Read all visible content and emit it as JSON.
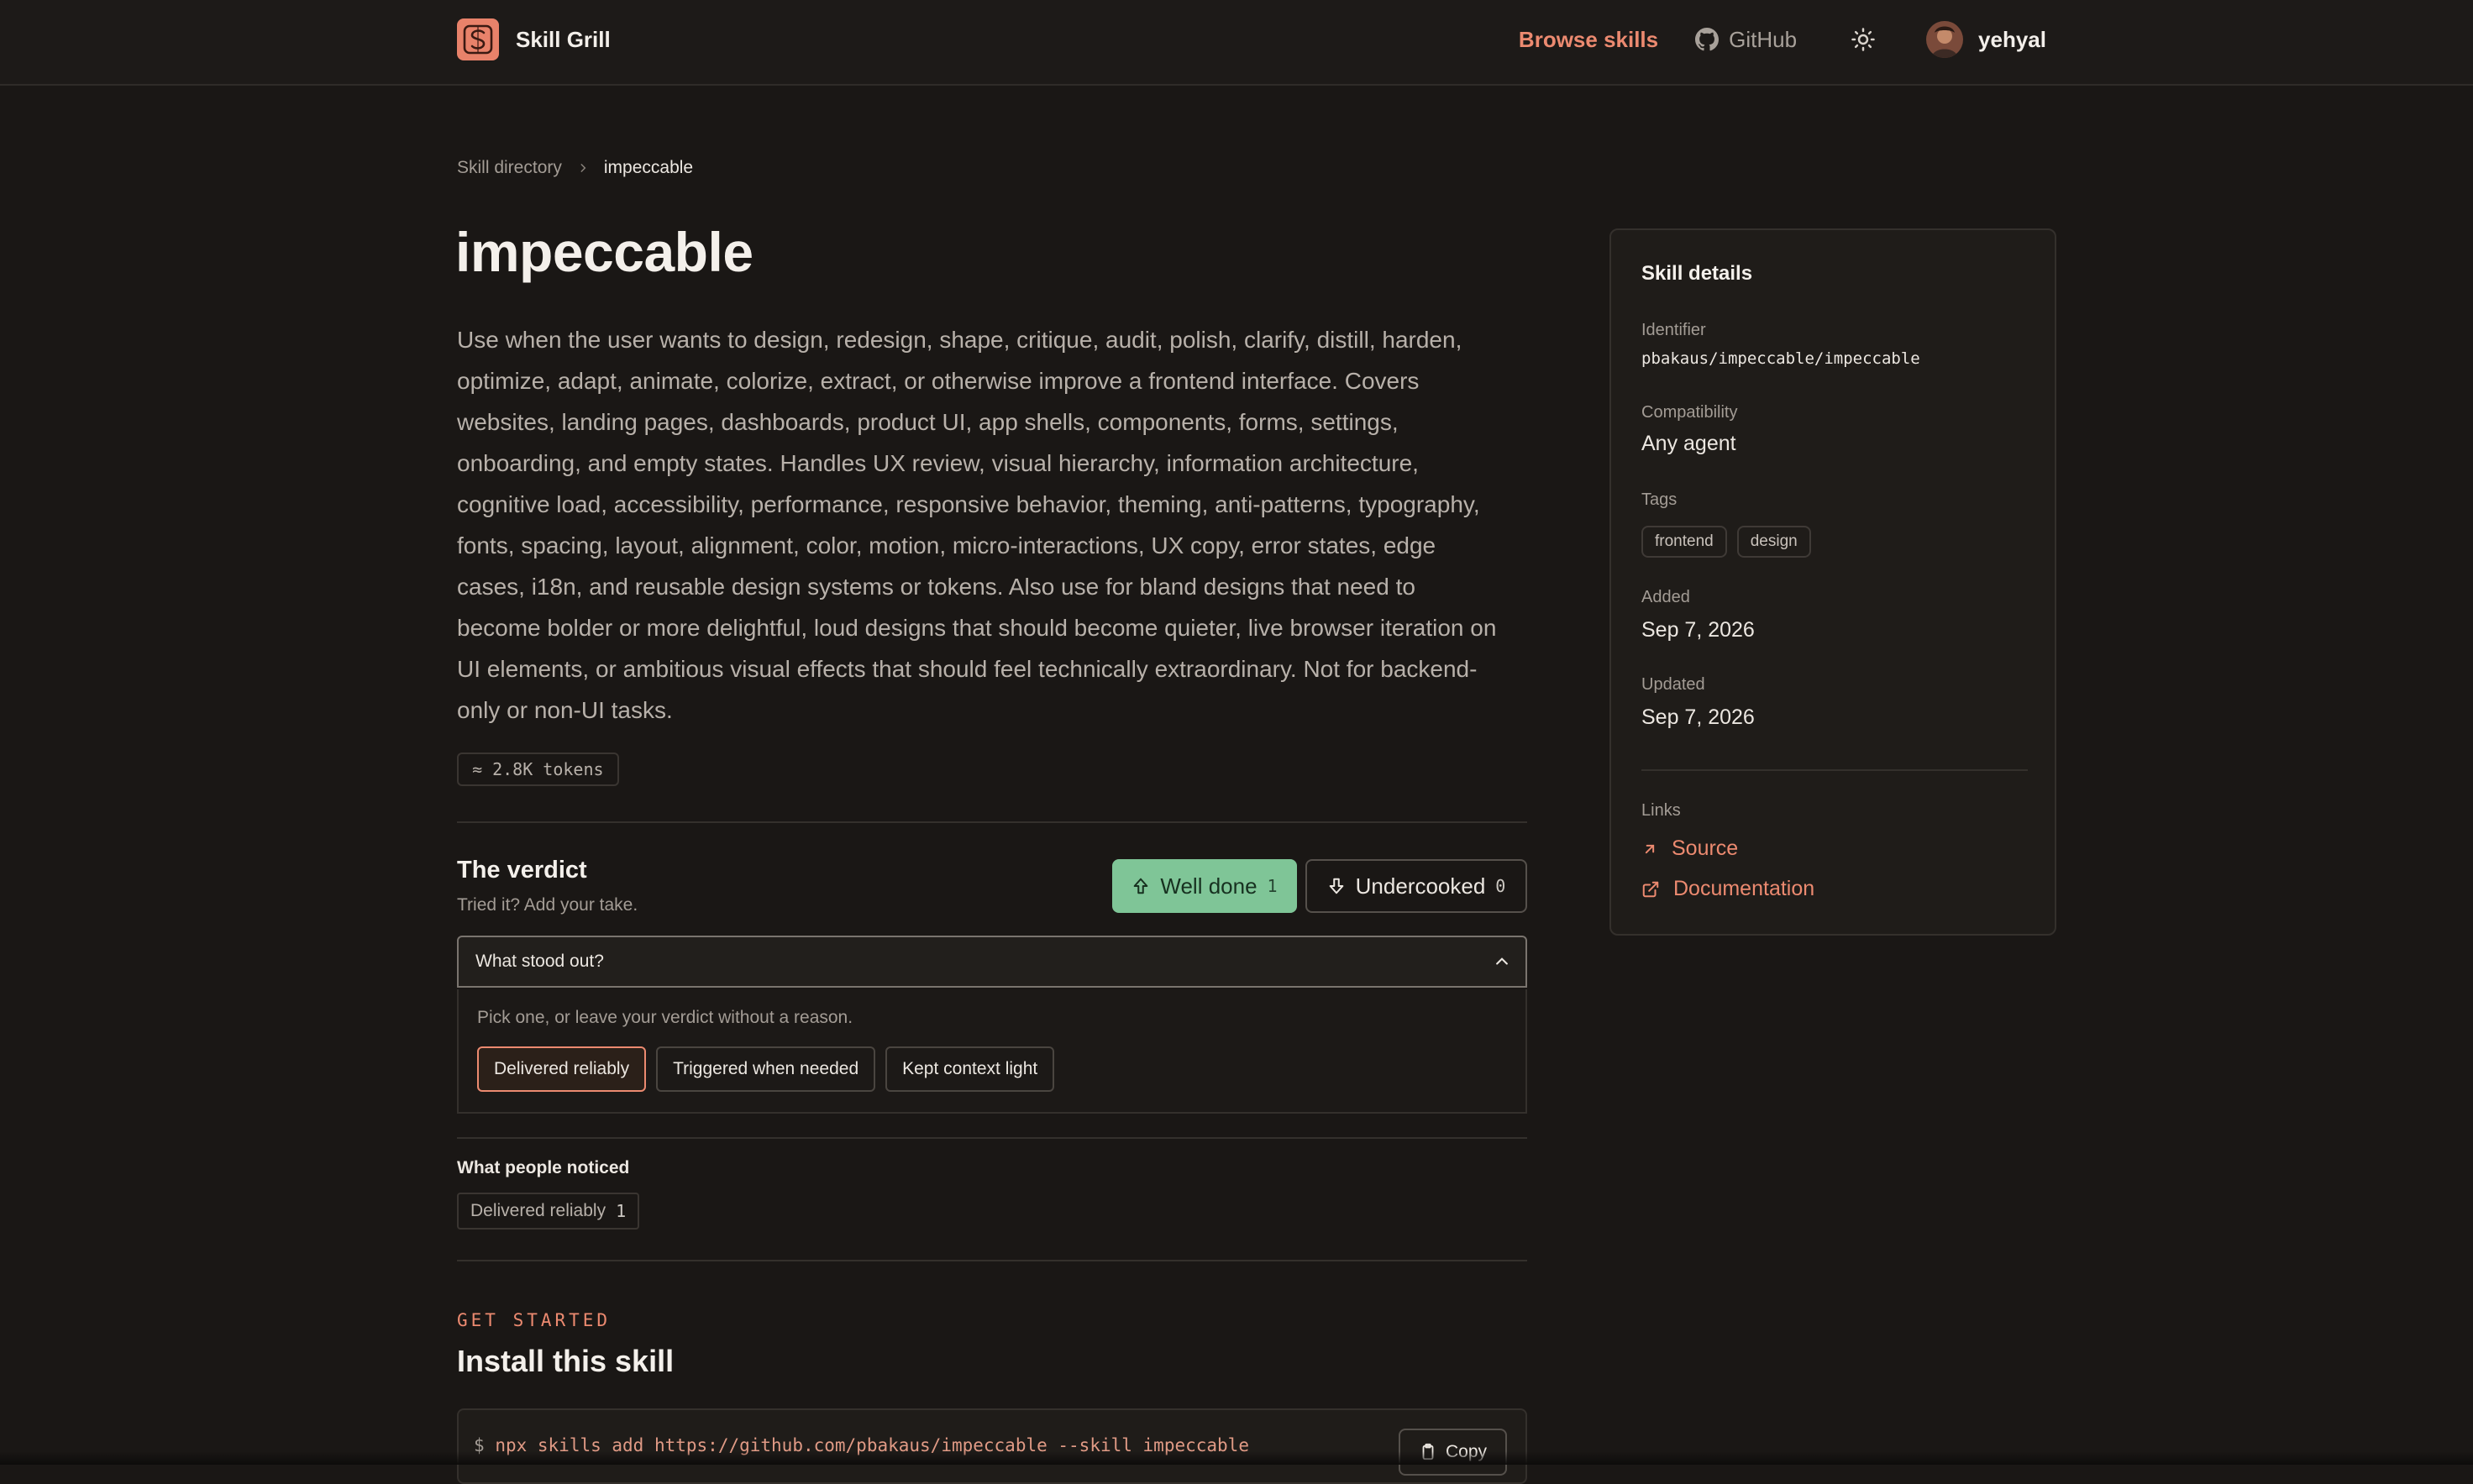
{
  "nav": {
    "brand": "Skill Grill",
    "browse_label": "Browse skills",
    "github_label": "GitHub",
    "username": "yehyal"
  },
  "breadcrumb": {
    "root": "Skill directory",
    "current": "impeccable"
  },
  "skill": {
    "title": "impeccable",
    "description": "Use when the user wants to design, redesign, shape, critique, audit, polish, clarify, distill, harden, optimize, adapt, animate, colorize, extract, or otherwise improve a frontend interface. Covers websites, landing pages, dashboards, product UI, app shells, components, forms, settings, onboarding, and empty states. Handles UX review, visual hierarchy, information architecture, cognitive load, accessibility, performance, responsive behavior, theming, anti-patterns, typography, fonts, spacing, layout, alignment, color, motion, micro-interactions, UX copy, error states, edge cases, i18n, and reusable design systems or tokens. Also use for bland designs that need to become bolder or more delightful, loud designs that should become quieter, live browser iteration on UI elements, or ambitious visual effects that should feel technically extraordinary. Not for backend-only or non-UI tasks.",
    "tokens": "≈ 2.8K tokens"
  },
  "verdict": {
    "title": "The verdict",
    "subtitle": "Tried it? Add your take.",
    "well_done_label": "Well done",
    "well_done_count": "1",
    "undercooked_label": "Undercooked",
    "undercooked_count": "0",
    "dropdown_label": "What stood out?",
    "hint": "Pick one, or leave your verdict without a reason.",
    "reasons": [
      "Delivered reliably",
      "Triggered when needed",
      "Kept context light"
    ],
    "selected_reason": "Delivered reliably"
  },
  "noticed": {
    "title": "What people noticed",
    "items": [
      {
        "label": "Delivered reliably",
        "count": "1"
      }
    ]
  },
  "install": {
    "eyebrow": "GET STARTED",
    "title": "Install this skill",
    "prompt": "$",
    "command": "npx skills add https://github.com/pbakaus/impeccable --skill impeccable",
    "copy_label": "Copy"
  },
  "details": {
    "title": "Skill details",
    "identifier_label": "Identifier",
    "identifier": "pbakaus/impeccable/impeccable",
    "compat_label": "Compatibility",
    "compat": "Any agent",
    "tags_label": "Tags",
    "tags": [
      "frontend",
      "design"
    ],
    "added_label": "Added",
    "added": "Sep 7, 2026",
    "updated_label": "Updated",
    "updated": "Sep 7, 2026",
    "links_label": "Links",
    "source_label": "Source",
    "docs_label": "Documentation"
  },
  "colors": {
    "accent": "#ec8a70",
    "well_done_bg": "#7fc597",
    "background": "#1a1715"
  }
}
